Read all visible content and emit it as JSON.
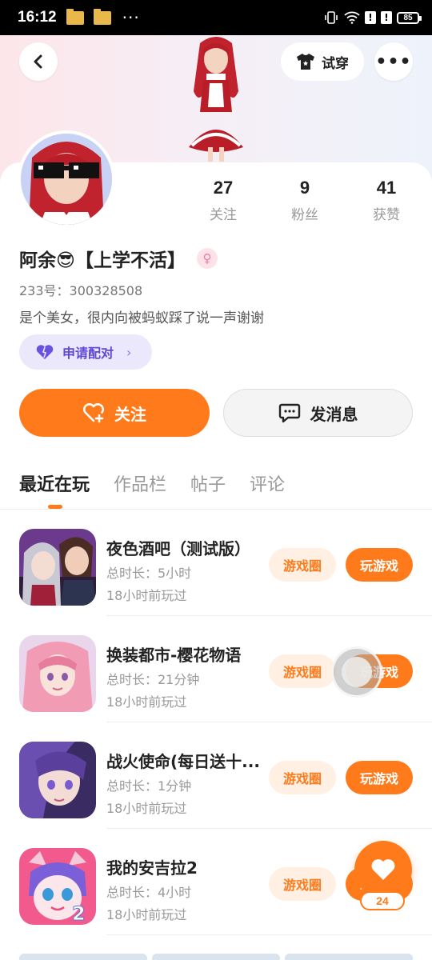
{
  "status_bar": {
    "time": "16:12",
    "battery": "85"
  },
  "header": {
    "tryon_label": "试穿",
    "more_label": "•••"
  },
  "profile": {
    "name": "阿余😎【上学不活】",
    "gender_symbol": "♀",
    "uid": "233号：300328508",
    "bio": "是个美女，很内向被蚂蚁踩了说一声谢谢",
    "pair_label": "申请配对",
    "stats": [
      {
        "value": "27",
        "label": "关注"
      },
      {
        "value": "9",
        "label": "粉丝"
      },
      {
        "value": "41",
        "label": "获赞"
      }
    ]
  },
  "actions": {
    "follow_label": "关注",
    "message_label": "发消息"
  },
  "tabs": [
    {
      "label": "最近在玩",
      "active": true
    },
    {
      "label": "作品栏",
      "active": false
    },
    {
      "label": "帖子",
      "active": false
    },
    {
      "label": "评论",
      "active": false
    }
  ],
  "games": [
    {
      "title": "夜色酒吧（测试版）",
      "duration": "总时长：5小时",
      "last_played": "18小时前玩过",
      "circle_label": "游戏圈",
      "play_label": "玩游戏"
    },
    {
      "title": "换装都市-樱花物语",
      "duration": "总时长：21分钟",
      "last_played": "18小时前玩过",
      "circle_label": "游戏圈",
      "play_label": "玩游戏"
    },
    {
      "title": "战火使命(每日送十...",
      "duration": "总时长：1分钟",
      "last_played": "18小时前玩过",
      "circle_label": "游戏圈",
      "play_label": "玩游戏"
    },
    {
      "title": "我的安吉拉2",
      "duration": "总时长：4小时",
      "last_played": "18小时前玩过",
      "circle_label": "游戏圈",
      "play_label": "玩游戏"
    }
  ],
  "like_fab": {
    "count": "24"
  },
  "colors": {
    "accent": "#ff7a1a",
    "pair_purple": "#6048d8"
  }
}
